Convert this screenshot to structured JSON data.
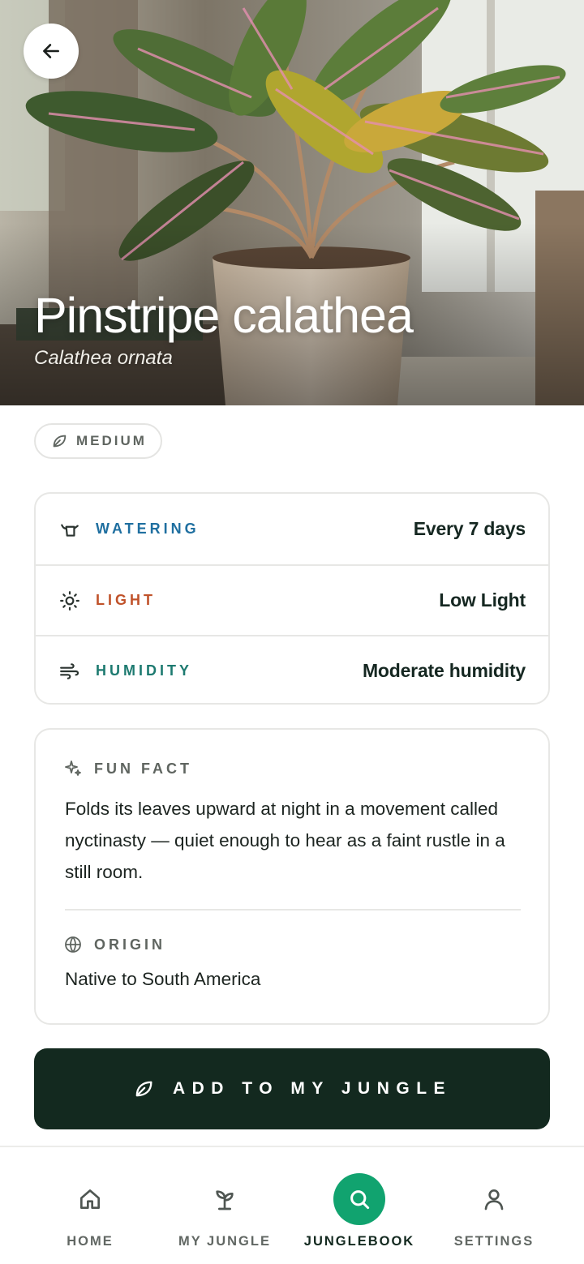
{
  "plant": {
    "name": "Pinstripe calathea",
    "scientific_name": "Calathea ornata",
    "difficulty": "MEDIUM"
  },
  "header": {
    "back_icon": "arrow-left-icon"
  },
  "care": [
    {
      "key": "watering",
      "label": "WATERING",
      "value": "Every 7 days",
      "icon": "watering-can-icon",
      "color": "#1f6fa0"
    },
    {
      "key": "light",
      "label": "LIGHT",
      "value": "Low Light",
      "icon": "sun-icon",
      "color": "#c0522a"
    },
    {
      "key": "humidity",
      "label": "HUMIDITY",
      "value": "Moderate humidity",
      "icon": "wind-icon",
      "color": "#1d7a70"
    }
  ],
  "fun_fact": {
    "label": "FUN FACT",
    "icon": "sparkles-icon",
    "text": "Folds its leaves upward at night in a movement called nyctinasty — quiet enough to hear as a faint rustle in a still room."
  },
  "origin": {
    "label": "ORIGIN",
    "icon": "globe-icon",
    "text": "Native to South America"
  },
  "cta": {
    "label": "ADD TO MY JUNGLE",
    "icon": "leaf-icon"
  },
  "nav": [
    {
      "label": "HOME",
      "icon": "home-icon",
      "active": false
    },
    {
      "label": "MY JUNGLE",
      "icon": "sprout-icon",
      "active": false
    },
    {
      "label": "JUNGLEBOOK",
      "icon": "search-icon",
      "active": true
    },
    {
      "label": "SETTINGS",
      "icon": "user-icon",
      "active": false
    }
  ],
  "colors": {
    "accent": "#11a36f",
    "dark": "#13291f",
    "watering": "#1f6fa0",
    "light": "#c0522a",
    "humidity": "#1d7a70"
  }
}
